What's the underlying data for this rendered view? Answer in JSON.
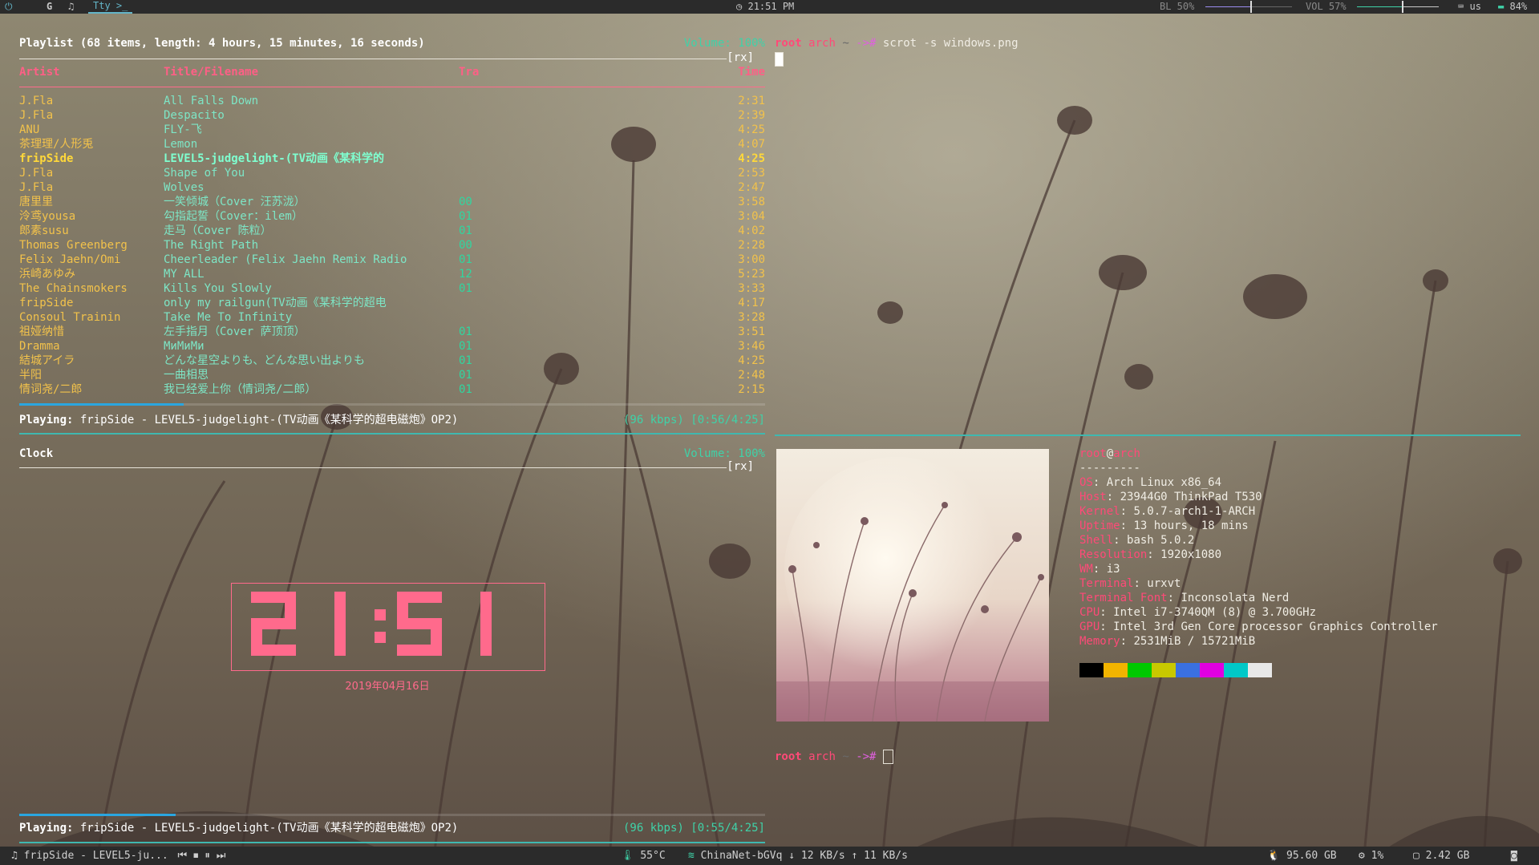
{
  "topbar": {
    "workspace_1": "G",
    "workspace_2": "♫",
    "workspace_3_label": "Tty",
    "workspace_3_icon": ">_",
    "clock": "21:51 PM",
    "backlight_label": "BL 50%",
    "backlight_level": 0.5,
    "volume_label": "VOL 57%",
    "volume_level": 0.57,
    "keyboard_layout": "us",
    "battery": "84%"
  },
  "ncmpcpp_playlist": {
    "header": "Playlist (68 items, length: 4 hours, 15 minutes, 16 seconds)",
    "volume": "Volume: 100%",
    "flags": "[rx]",
    "columns": [
      "Artist",
      "Title/Filename",
      "Tra",
      "Time"
    ],
    "rows": [
      {
        "artist": "J.Fla",
        "title": "All Falls Down",
        "track": "",
        "time": "2:31",
        "current": false
      },
      {
        "artist": "J.Fla",
        "title": "Despacito",
        "track": "",
        "time": "2:39",
        "current": false
      },
      {
        "artist": "ANU",
        "title": "FLY-飞",
        "track": "",
        "time": "4:25",
        "current": false
      },
      {
        "artist": "茶理理/人形兎",
        "title": "Lemon",
        "track": "",
        "time": "4:07",
        "current": false
      },
      {
        "artist": "fripSide",
        "title": "LEVEL5-judgelight-(TV动画《某科学的",
        "track": "",
        "time": "4:25",
        "current": true
      },
      {
        "artist": "J.Fla",
        "title": "Shape of You",
        "track": "",
        "time": "2:53",
        "current": false
      },
      {
        "artist": "J.Fla",
        "title": "Wolves",
        "track": "",
        "time": "2:47",
        "current": false
      },
      {
        "artist": "唐里里",
        "title": "一笑倾城（Cover 汪苏泷）",
        "track": "00",
        "time": "3:58",
        "current": false
      },
      {
        "artist": "泠鸢yousa",
        "title": "勾指起誓（Cover：ilem）",
        "track": "01",
        "time": "3:04",
        "current": false
      },
      {
        "artist": "郎素susu",
        "title": "走马（Cover 陈粒）",
        "track": "01",
        "time": "4:02",
        "current": false
      },
      {
        "artist": "Thomas Greenberg",
        "title": "The Right Path",
        "track": "00",
        "time": "2:28",
        "current": false
      },
      {
        "artist": "Felix Jaehn/Omi",
        "title": "Cheerleader (Felix Jaehn Remix Radio",
        "track": "01",
        "time": "3:00",
        "current": false
      },
      {
        "artist": "浜崎あゆみ",
        "title": "MY ALL",
        "track": "12",
        "time": "5:23",
        "current": false
      },
      {
        "artist": "The Chainsmokers",
        "title": "Kills You Slowly",
        "track": "01",
        "time": "3:33",
        "current": false
      },
      {
        "artist": "fripSide",
        "title": "only my railgun(TV动画《某科学的超电",
        "track": "",
        "time": "4:17",
        "current": false
      },
      {
        "artist": "Consoul Trainin",
        "title": "Take Me To Infinity",
        "track": "",
        "time": "3:28",
        "current": false
      },
      {
        "artist": "祖娅纳惜",
        "title": "左手指月（Cover 萨顶顶）",
        "track": "01",
        "time": "3:51",
        "current": false
      },
      {
        "artist": "Dramma",
        "title": "МиМиМи",
        "track": "01",
        "time": "3:46",
        "current": false
      },
      {
        "artist": "結城アイラ",
        "title": "どんな星空よりも、どんな思い出よりも",
        "track": "01",
        "time": "4:25",
        "current": false
      },
      {
        "artist": "半阳",
        "title": "一曲相思",
        "track": "01",
        "time": "2:48",
        "current": false
      },
      {
        "artist": "情词尧/二郎",
        "title": "我已经爱上你（情词尧/二郎）",
        "track": "01",
        "time": "2:15",
        "current": false
      }
    ],
    "progress": 0.22,
    "status_label": "Playing:",
    "status_song": "fripSide - LEVEL5-judgelight-(TV动画《某科学的超电磁炮》OP2)",
    "status_info": "(96 kbps) [0:56/4:25]"
  },
  "ncmpcpp_clock": {
    "header": "Clock",
    "volume": "Volume: 100%",
    "flags": "[rx]",
    "time": "21:51",
    "date": "2019年04月16日",
    "progress": 0.21,
    "status_label": "Playing:",
    "status_song": "fripSide - LEVEL5-judgelight-(TV动画《某科学的超电磁炮》OP2)",
    "status_info": "(96 kbps) [0:55/4:25]"
  },
  "terminal_top": {
    "user": "root",
    "host": "arch",
    "cwd": "~",
    "arrow": "->",
    "sigil": "#",
    "command": "scrot -s windows.png"
  },
  "neofetch": {
    "user": "root",
    "at": "@",
    "host": "arch",
    "separator": "---------",
    "fields": [
      {
        "key": "OS",
        "value": "Arch Linux x86_64"
      },
      {
        "key": "Host",
        "value": "23944G0 ThinkPad T530"
      },
      {
        "key": "Kernel",
        "value": "5.0.7-arch1-1-ARCH"
      },
      {
        "key": "Uptime",
        "value": "13 hours, 18 mins"
      },
      {
        "key": "Shell",
        "value": "bash 5.0.2"
      },
      {
        "key": "Resolution",
        "value": "1920x1080"
      },
      {
        "key": "WM",
        "value": "i3"
      },
      {
        "key": "Terminal",
        "value": "urxvt"
      },
      {
        "key": "Terminal Font",
        "value": "Inconsolata Nerd"
      },
      {
        "key": "CPU",
        "value": "Intel i7-3740QM (8) @ 3.700GHz"
      },
      {
        "key": "GPU",
        "value": "Intel 3rd Gen Core processor Graphics Controller"
      },
      {
        "key": "Memory",
        "value": "2531MiB / 15721MiB"
      }
    ],
    "palette": [
      "#000000",
      "#f2b400",
      "#00c800",
      "#c8c800",
      "#3a70e0",
      "#e000e0",
      "#00c8c8",
      "#e8e8e8"
    ],
    "prompt_user": "root",
    "prompt_host": "arch",
    "prompt_cwd": "~",
    "prompt_arrow": "->",
    "prompt_sigil": "#"
  },
  "bottombar": {
    "music": "fripSide - LEVEL5-ju...",
    "temp": "55°C",
    "wifi": "ChinaNet-bGVq",
    "down": "12 KB/s",
    "up": "11 KB/s",
    "disk_free": "95.60 GB",
    "cpu": "1%",
    "mem": "2.42 GB"
  },
  "colors": {
    "accent_pink": "#ff4a78",
    "accent_teal": "#3fb8b0",
    "artist_yellow": "#f2c24b",
    "title_cyan": "#7de6c6"
  }
}
